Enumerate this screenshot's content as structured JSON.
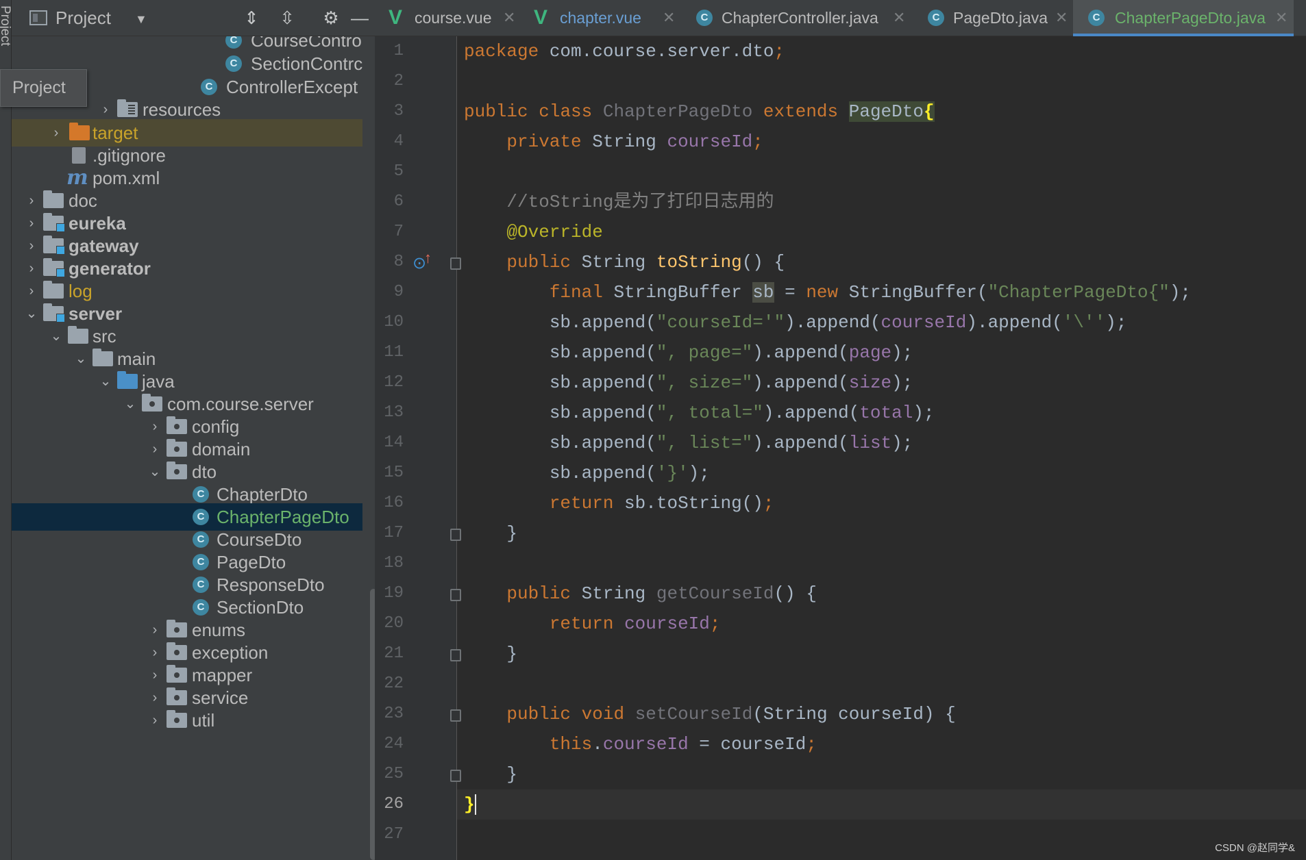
{
  "strip_label": "Project",
  "project": {
    "title": "Project",
    "tooltip": "Project",
    "tree": [
      {
        "label": "CourseContro",
        "icon": "class"
      },
      {
        "label": "SectionContrc",
        "icon": "class"
      },
      {
        "label": "ControllerExcept",
        "icon": "class"
      },
      {
        "label": "resources",
        "icon": "folder-res"
      },
      {
        "label": "target",
        "icon": "folder-orange"
      },
      {
        "label": ".gitignore",
        "icon": "git"
      },
      {
        "label": "pom.xml",
        "icon": "maven"
      },
      {
        "label": "doc",
        "icon": "folder"
      },
      {
        "label": "eureka",
        "icon": "module"
      },
      {
        "label": "gateway",
        "icon": "module"
      },
      {
        "label": "generator",
        "icon": "module"
      },
      {
        "label": "log",
        "icon": "folder"
      },
      {
        "label": "server",
        "icon": "module"
      },
      {
        "label": "src",
        "icon": "folder"
      },
      {
        "label": "main",
        "icon": "folder"
      },
      {
        "label": "java",
        "icon": "folder-blue"
      },
      {
        "label": "com.course.server",
        "icon": "package"
      },
      {
        "label": "config",
        "icon": "package"
      },
      {
        "label": "domain",
        "icon": "package"
      },
      {
        "label": "dto",
        "icon": "package"
      },
      {
        "label": "ChapterDto",
        "icon": "class"
      },
      {
        "label": "ChapterPageDto",
        "icon": "class"
      },
      {
        "label": "CourseDto",
        "icon": "class"
      },
      {
        "label": "PageDto",
        "icon": "class"
      },
      {
        "label": "ResponseDto",
        "icon": "class"
      },
      {
        "label": "SectionDto",
        "icon": "class"
      },
      {
        "label": "enums",
        "icon": "package"
      },
      {
        "label": "exception",
        "icon": "package"
      },
      {
        "label": "mapper",
        "icon": "package"
      },
      {
        "label": "service",
        "icon": "package"
      },
      {
        "label": "util",
        "icon": "package"
      }
    ]
  },
  "tabs": [
    {
      "label": "course.vue",
      "type": "vue"
    },
    {
      "label": "chapter.vue",
      "type": "vue"
    },
    {
      "label": "ChapterController.java",
      "type": "java"
    },
    {
      "label": "PageDto.java",
      "type": "java"
    },
    {
      "label": "ChapterPageDto.java",
      "type": "java",
      "active": true
    }
  ],
  "line_numbers": [
    "1",
    "2",
    "3",
    "4",
    "5",
    "6",
    "7",
    "8",
    "9",
    "10",
    "11",
    "12",
    "13",
    "14",
    "15",
    "16",
    "17",
    "18",
    "19",
    "20",
    "21",
    "22",
    "23",
    "24",
    "25",
    "26",
    "27"
  ],
  "code": {
    "l1": {
      "kw": "package",
      "rest": " com.course.server.dto",
      "semi": ";"
    },
    "l3": {
      "kw1": "public",
      "kw2": "class",
      "name": "ChapterPageDto",
      "kw3": "extends",
      "parent": "PageDto",
      "brace": "{"
    },
    "l4": {
      "kw": "private",
      "type": " String ",
      "field": "courseId",
      "semi": ";"
    },
    "l6": {
      "comment": "//toString是为了打印日志用的"
    },
    "l7": {
      "ann": "@Override"
    },
    "l8": {
      "kw": "public",
      "type": " String ",
      "fn": "toString",
      "rest": "() {"
    },
    "l9": {
      "kw": "final",
      "type": " StringBuffer ",
      "var": "sb",
      "eq": " = ",
      "kw2": "new",
      "ctor": " StringBuffer(",
      "str": "\"ChapterPageDto{\"",
      "end": ");"
    },
    "l10": {
      "a": "sb.append(",
      "s1": "\"courseId='\"",
      "b": ").append(",
      "f": "courseId",
      "c": ").append(",
      "s2": "'\\''",
      "d": ");"
    },
    "l11": {
      "a": "sb.append(",
      "s": "\", page=\"",
      "b": ").append(",
      "f": "page",
      "c": ");"
    },
    "l12": {
      "a": "sb.append(",
      "s": "\", size=\"",
      "b": ").append(",
      "f": "size",
      "c": ");"
    },
    "l13": {
      "a": "sb.append(",
      "s": "\", total=\"",
      "b": ").append(",
      "f": "total",
      "c": ");"
    },
    "l14": {
      "a": "sb.append(",
      "s": "\", list=\"",
      "b": ").append(",
      "f": "list",
      "c": ");"
    },
    "l15": {
      "a": "sb.append(",
      "s": "'}'",
      "c": ");"
    },
    "l16": {
      "kw": "return",
      "rest": " sb.toString()",
      "semi": ";"
    },
    "l17": {
      "t": "}"
    },
    "l19": {
      "kw": "public",
      "type": " String ",
      "fn": "getCourseId",
      "rest": "() {"
    },
    "l20": {
      "kw": "return",
      "sp": " ",
      "f": "courseId",
      "semi": ";"
    },
    "l21": {
      "t": "}"
    },
    "l23": {
      "kw1": "public",
      "kw2": "void",
      "fn": "setCourseId",
      "rest": "(String courseId) {"
    },
    "l24": {
      "kw": "this",
      "dot": ".",
      "f": "courseId",
      "rest": " = courseId",
      "semi": ";"
    },
    "l25": {
      "t": "}"
    },
    "l26": {
      "t": "}"
    }
  },
  "watermark": "CSDN @赵同学&"
}
